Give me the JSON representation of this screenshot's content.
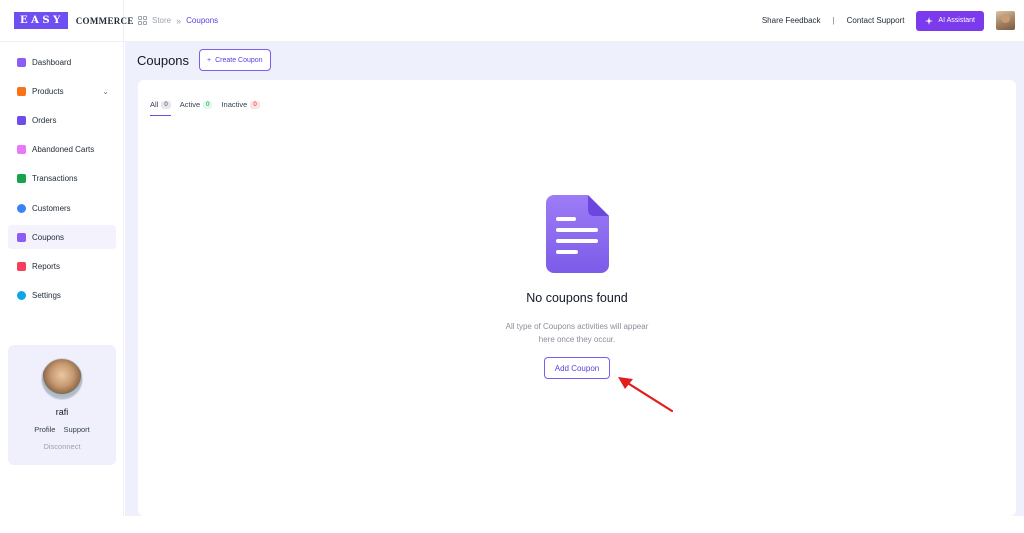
{
  "brand": {
    "logo_text": "EASY",
    "commerce_text": "COMMERCE"
  },
  "breadcrumb": {
    "parent": "Store",
    "separator": "»",
    "current": "Coupons"
  },
  "topbar": {
    "share_feedback": "Share Feedback",
    "divider": "|",
    "contact_support": "Contact Support",
    "ai_assistant": "AI Assistant"
  },
  "sidebar": {
    "items": [
      {
        "label": "Dashboard",
        "icon": "dashboard-icon",
        "color": "#8b5cf6"
      },
      {
        "label": "Products",
        "icon": "products-icon",
        "color": "#f97316"
      },
      {
        "label": "Orders",
        "icon": "orders-icon",
        "color": "#6d4ee8"
      },
      {
        "label": "Abandoned Carts",
        "icon": "cart-icon",
        "color": "#e879f9"
      },
      {
        "label": "Transactions",
        "icon": "transactions-icon",
        "color": "#16a34a"
      },
      {
        "label": "Customers",
        "icon": "customers-icon",
        "color": "#3b82f6"
      },
      {
        "label": "Coupons",
        "icon": "coupons-icon",
        "color": "#8b5cf6"
      },
      {
        "label": "Reports",
        "icon": "reports-icon",
        "color": "#f43f5e"
      },
      {
        "label": "Settings",
        "icon": "settings-icon",
        "color": "#0ea5e9"
      }
    ],
    "products_chevron": "⌄"
  },
  "profile": {
    "name": "rafi",
    "profile_link": "Profile",
    "support_link": "Support",
    "disconnect": "Disconnect"
  },
  "main": {
    "title": "Coupons",
    "create_button": "Create Coupon",
    "create_button_prefix": "+",
    "tabs": [
      {
        "label": "All",
        "count": "0"
      },
      {
        "label": "Active",
        "count": "0"
      },
      {
        "label": "Inactive",
        "count": "0"
      }
    ],
    "empty": {
      "title": "No coupons found",
      "description": "All type of Coupons activities will appear here once they occur.",
      "button": "Add Coupon"
    }
  },
  "colors": {
    "accent": "#7c3aed",
    "annotation_arrow": "#e11d1d"
  }
}
